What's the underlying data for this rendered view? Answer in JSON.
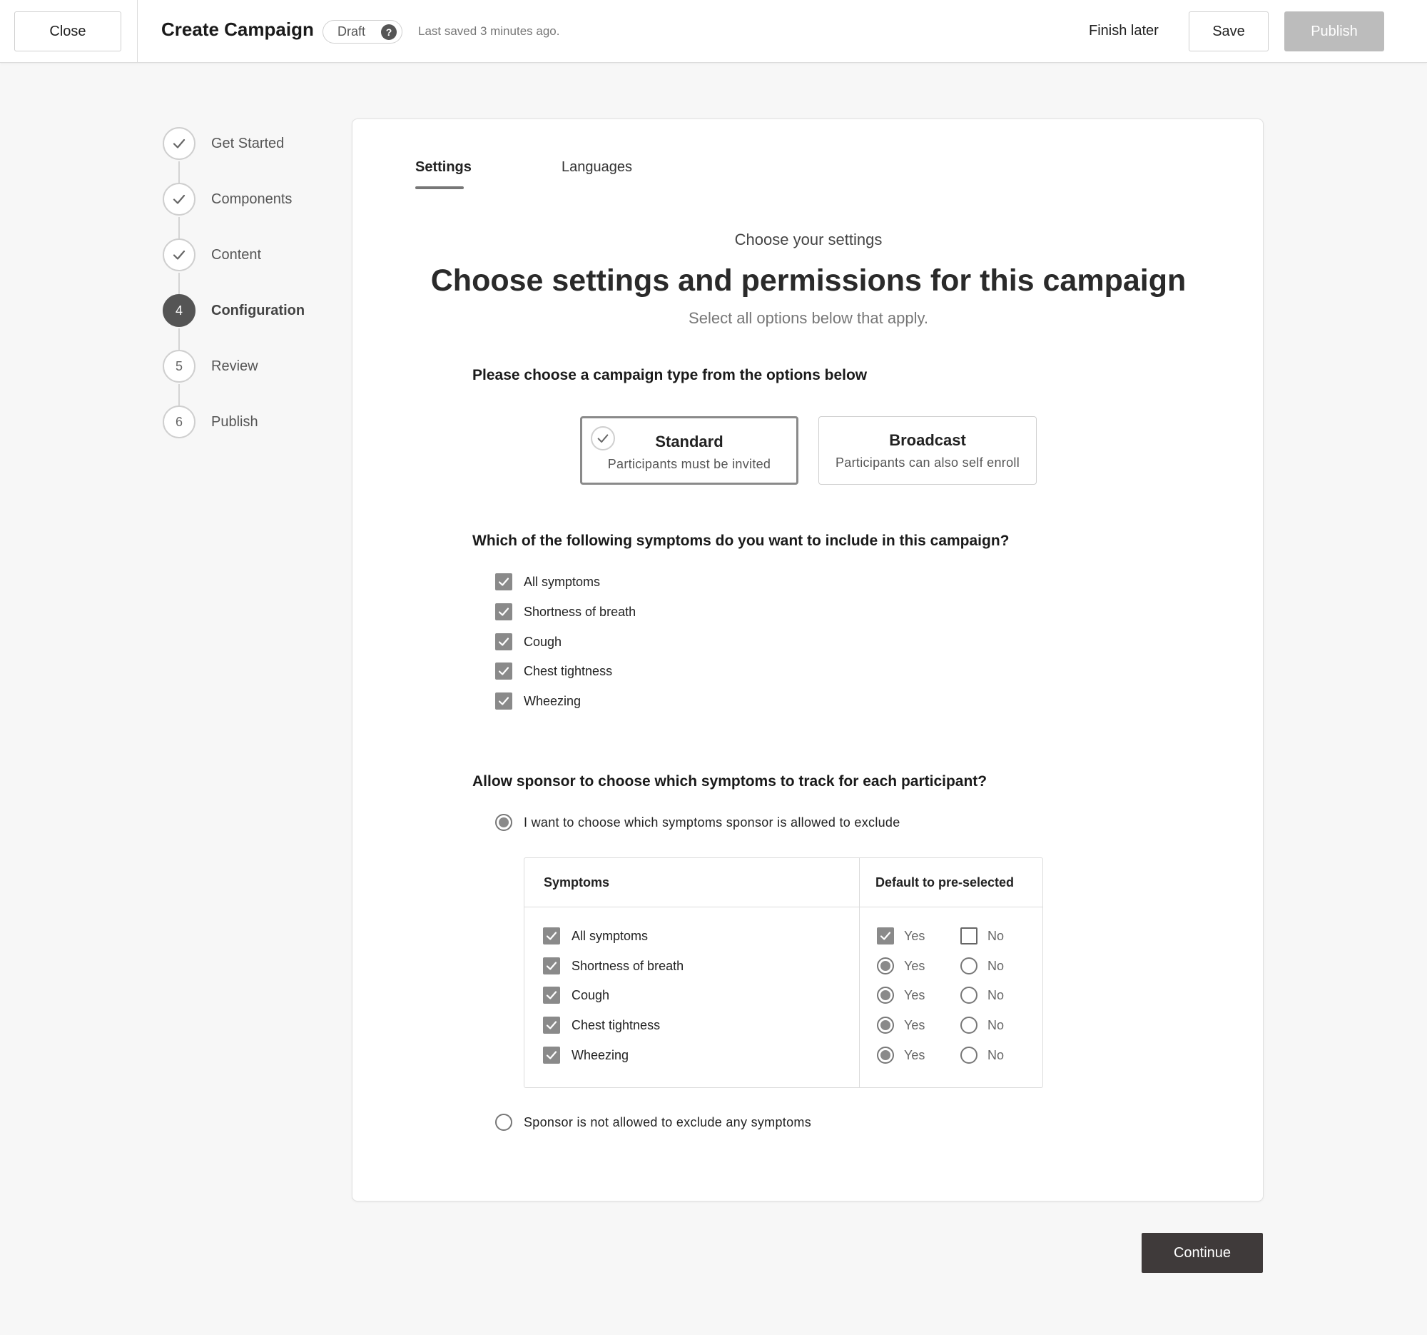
{
  "header": {
    "close_label": "Close",
    "title": "Create Campaign",
    "status": "Draft",
    "help_glyph": "?",
    "last_saved": "Last saved 3 minutes ago.",
    "finish_later_label": "Finish later",
    "save_label": "Save",
    "publish_label": "Publish"
  },
  "steps": [
    {
      "label": "Get Started",
      "state": "complete",
      "marker": ""
    },
    {
      "label": "Components",
      "state": "complete",
      "marker": ""
    },
    {
      "label": "Content",
      "state": "complete",
      "marker": ""
    },
    {
      "label": "Configuration",
      "state": "active",
      "marker": "4"
    },
    {
      "label": "Review",
      "state": "pending",
      "marker": "5"
    },
    {
      "label": "Publish",
      "state": "pending",
      "marker": "6"
    }
  ],
  "tabs": [
    {
      "label": "Settings",
      "active": true
    },
    {
      "label": "Languages",
      "active": false
    }
  ],
  "intro": {
    "eyebrow": "Choose your settings",
    "headline": "Choose settings and permissions for this campaign",
    "subhead": "Select all options below that apply."
  },
  "campaign_type": {
    "question": "Please choose a campaign type from the options below",
    "options": [
      {
        "title": "Standard",
        "description": "Participants must be invited",
        "selected": true
      },
      {
        "title": "Broadcast",
        "description": "Participants can also self enroll",
        "selected": false
      }
    ]
  },
  "symptoms": {
    "question": "Which of the following symptoms do you want to include in this campaign?",
    "items": [
      {
        "label": "All symptoms",
        "checked": true
      },
      {
        "label": "Shortness of breath",
        "checked": true
      },
      {
        "label": "Cough",
        "checked": true
      },
      {
        "label": "Chest tightness",
        "checked": true
      },
      {
        "label": "Wheezing",
        "checked": true
      }
    ]
  },
  "sponsor": {
    "question": "Allow sponsor to choose which symptoms to track for each participant?",
    "option_choose": "I want to choose which symptoms sponsor is allowed to exclude",
    "option_choose_selected": true,
    "option_none": "Sponsor is not allowed to exclude any symptoms",
    "option_none_selected": false,
    "table": {
      "col_symptoms": "Symptoms",
      "col_default": "Default to pre-selected",
      "yes_label": "Yes",
      "no_label": "No",
      "rows": [
        {
          "label": "All symptoms",
          "checked": true,
          "yes": true,
          "no": false,
          "control": "checkbox"
        },
        {
          "label": "Shortness of breath",
          "checked": true,
          "yes": true,
          "no": false,
          "control": "radio"
        },
        {
          "label": "Cough",
          "checked": true,
          "yes": true,
          "no": false,
          "control": "radio"
        },
        {
          "label": "Chest tightness",
          "checked": true,
          "yes": true,
          "no": false,
          "control": "radio"
        },
        {
          "label": "Wheezing",
          "checked": true,
          "yes": true,
          "no": false,
          "control": "radio"
        }
      ]
    }
  },
  "footer": {
    "continue_label": "Continue"
  },
  "colors": {
    "primary_dark": "#3f3a3a",
    "disabled_button": "#bcbcbc",
    "checkbox_fill": "#8a8a8a"
  }
}
